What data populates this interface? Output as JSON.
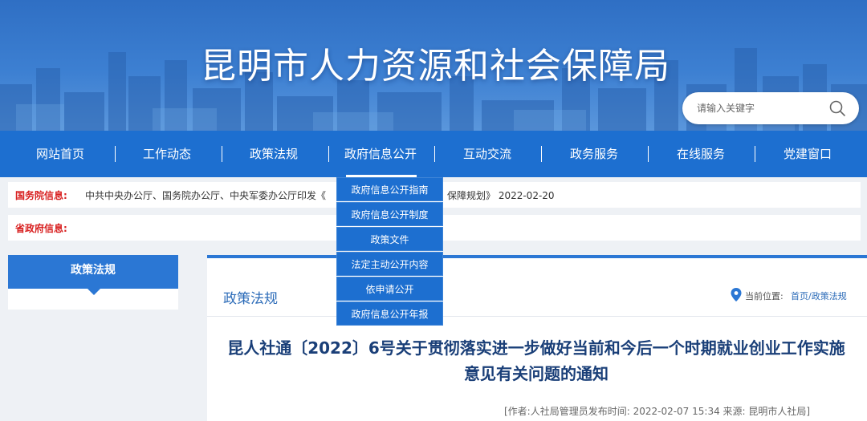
{
  "site": {
    "title": "昆明市人力资源和社会保障局"
  },
  "search": {
    "placeholder": "请输入关键字"
  },
  "nav": {
    "items": [
      "网站首页",
      "工作动态",
      "政策法规",
      "政府信息公开",
      "互动交流",
      "政务服务",
      "在线服务",
      "党建窗口"
    ]
  },
  "dropdown": {
    "items": [
      "政府信息公开指南",
      "政府信息公开制度",
      "政策文件",
      "法定主动公开内容",
      "依申请公开",
      "政府信息公开年报"
    ]
  },
  "info": {
    "state_label": "国务院信息:",
    "state_text": "中共中央办公厅、国务院办公厅、中央军委办公厅印发《",
    "state_text_tail": "保障规划》 2022-02-20",
    "province_label": "省政府信息:"
  },
  "sidebar": {
    "title": "政策法规"
  },
  "main": {
    "section_title": "政策法规",
    "location_label": "当前位置:",
    "location_path": "首页/政策法规",
    "article_title": "昆人社通〔2022〕6号关于贯彻落实进一步做好当前和今后一个时期就业创业工作实施意见有关问题的通知",
    "meta": "[作者:人社局管理员发布时间: 2022-02-07 15:34 来源: 昆明市人社局]"
  },
  "colors": {
    "nav": "#1d6fd0",
    "accent": "#2b77d4",
    "label_red": "#d82020",
    "title_blue": "#1a3f78"
  }
}
